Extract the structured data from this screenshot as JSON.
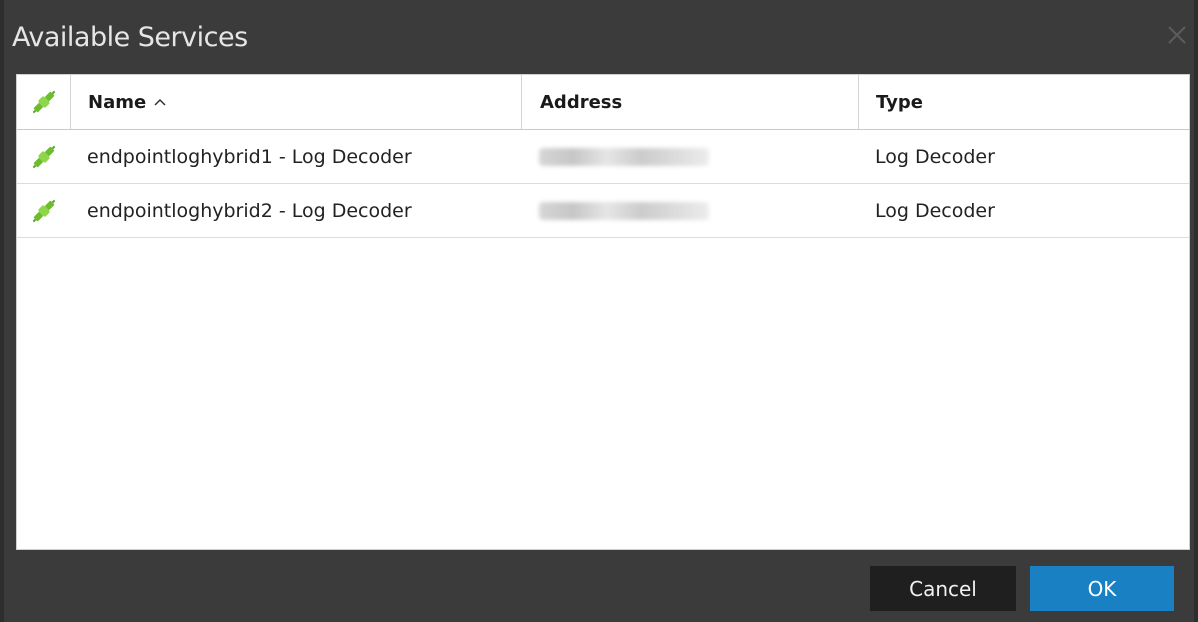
{
  "dialog": {
    "title": "Available Services",
    "close_icon": "close-icon"
  },
  "table": {
    "columns": {
      "status_icon": "plug-connected-icon",
      "name": "Name",
      "name_sort": "^",
      "address": "Address",
      "type": "Type"
    },
    "rows": [
      {
        "status_icon": "plug-connected-icon",
        "name": "endpointloghybrid1 - Log Decoder",
        "address": "",
        "type": "Log Decoder"
      },
      {
        "status_icon": "plug-connected-icon",
        "name": "endpointloghybrid2 - Log Decoder",
        "address": "",
        "type": "Log Decoder"
      }
    ]
  },
  "buttons": {
    "cancel": "Cancel",
    "ok": "OK"
  },
  "colors": {
    "ok_button": "#1a80c4",
    "cancel_button": "#1f1f1f",
    "dialog_bg": "#3b3b3b",
    "plug_icon": "#7cc63a"
  }
}
